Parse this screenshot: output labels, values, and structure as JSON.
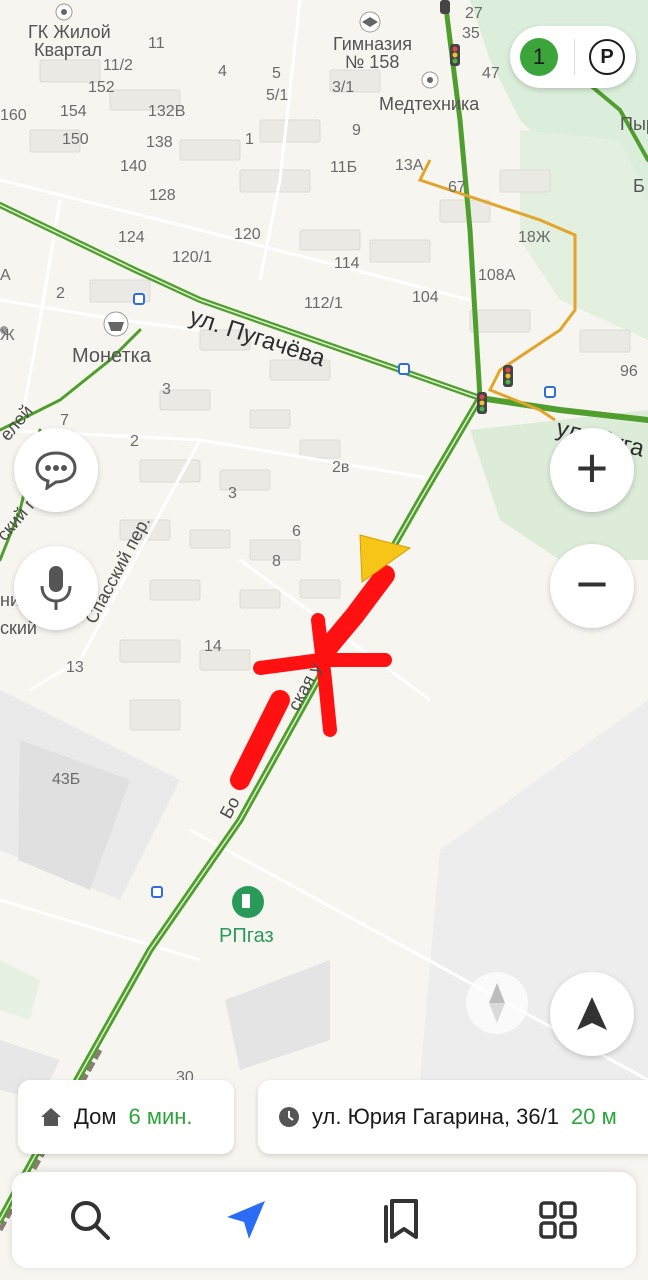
{
  "map": {
    "streets": [
      {
        "name": "ул. Пугачёва",
        "id": "street-pugacheva"
      },
      {
        "name": "ул. Пуга",
        "id": "street-pugacheva-right"
      },
      {
        "name": "Спасский пер.",
        "id": "street-spassky"
      },
      {
        "name": "Бо",
        "id": "street-bo"
      },
      {
        "name": "ская у",
        "id": "street-bo-mid"
      },
      {
        "name": "елей",
        "id": "street-fragment-left"
      },
      {
        "name": "ский пер.",
        "id": "street-fragment-left2"
      },
      {
        "name": "ница",
        "id": "street-fragment-left3"
      },
      {
        "name": "ский",
        "id": "street-fragment-left4"
      }
    ],
    "pois": [
      {
        "name": "ГК Жилой\nКвартал",
        "line1": "ГК Жилой",
        "line2": "Квартал",
        "icon": "pin-icon"
      },
      {
        "name": "Гимназия № 158",
        "line1": "Гимназия",
        "line2": "№ 158",
        "icon": "school-icon"
      },
      {
        "name": "Медтехника",
        "icon": "pin-icon"
      },
      {
        "name": "Монетка",
        "icon": "shopping-basket-icon"
      },
      {
        "name": "РПгаз",
        "icon": "gas-station-icon"
      },
      {
        "name": "Пыр",
        "icon": "none"
      },
      {
        "name": "Б",
        "icon": "none"
      }
    ],
    "house_numbers": [
      "11",
      "11/2",
      "152",
      "160",
      "154",
      "150",
      "140",
      "132В",
      "138",
      "128",
      "124",
      "120/1",
      "120",
      "4",
      "1",
      "5",
      "5/1",
      "3/1",
      "9",
      "11Б",
      "13А",
      "67",
      "18Ж",
      "108А",
      "114",
      "112/1",
      "104",
      "27",
      "35",
      "47",
      "2",
      "3",
      "7",
      "2",
      "3",
      "2в",
      "6",
      "8",
      "14",
      "13",
      "43Б",
      "30",
      "96",
      "А",
      "Ж"
    ]
  },
  "traffic": {
    "level": "1",
    "level_color": "#3ba53b",
    "parking_label": "P"
  },
  "controls": {
    "zoom_in": "+",
    "zoom_out": "−"
  },
  "destinations": {
    "home": {
      "icon": "home-icon",
      "label": "Дом",
      "time": "6 мин.",
      "time_color": "#2aa53a"
    },
    "work": {
      "icon": "clock-icon",
      "label": "ул. Юрия Гагарина, 36/1",
      "time": "20 м",
      "time_color": "#2aa53a"
    }
  },
  "bottom_nav": [
    {
      "name": "search",
      "icon": "search-icon"
    },
    {
      "name": "navigator",
      "icon": "navigation-arrow-icon",
      "color": "#2a6df4"
    },
    {
      "name": "bookmarks",
      "icon": "bookmarks-icon"
    },
    {
      "name": "services",
      "icon": "grid-icon"
    }
  ],
  "colors": {
    "road_green": "#4f9e2e",
    "detour_orange": "#e2a42a",
    "annotation_red": "#ff1111",
    "user_arrow": "#f5c518",
    "bus_stop": "#2f6ed8"
  }
}
